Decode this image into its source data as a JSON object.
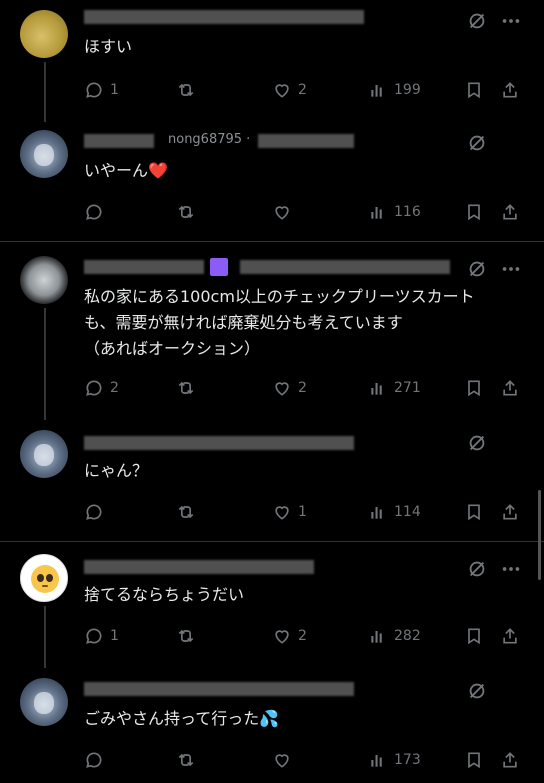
{
  "posts": [
    {
      "text": "ほすい",
      "name_partial": "",
      "handle_partial": "",
      "reply_count": "1",
      "repost_count": "",
      "like_count": "2",
      "view_count": "199"
    },
    {
      "text": "いやーん",
      "emoji": "❤️",
      "name_partial": "",
      "handle_partial": "nong68795 · ",
      "reply_count": "",
      "repost_count": "",
      "like_count": "",
      "view_count": "116"
    },
    {
      "text": "私の家にある100cm以上のチェックプリーツスカート\nも、需要が無ければ廃棄処分も考えています\n（あればオークション）",
      "name_partial": "",
      "handle_partial": "",
      "reply_count": "2",
      "repost_count": "",
      "like_count": "2",
      "view_count": "271"
    },
    {
      "text": "にゃん？",
      "name_partial": "",
      "handle_partial": "",
      "reply_count": "",
      "repost_count": "",
      "like_count": "1",
      "view_count": "114"
    },
    {
      "text": "捨てるならちょうだい",
      "name_partial": "",
      "handle_partial": "",
      "reply_count": "1",
      "repost_count": "",
      "like_count": "2",
      "view_count": "282"
    },
    {
      "text": "ごみやさん持って行った",
      "emoji": "💦",
      "name_partial": "",
      "handle_partial": "",
      "reply_count": "",
      "repost_count": "",
      "like_count": "",
      "view_count": "173"
    }
  ],
  "icons": {
    "reply": "reply-icon",
    "repost": "repost-icon",
    "like": "heart-icon",
    "views": "views-icon",
    "bookmark": "bookmark-icon",
    "share": "share-icon",
    "grok": "grok-icon",
    "more": "more-icon"
  },
  "colors": {
    "background": "#000000",
    "text": "#e7e9ea",
    "muted": "#71767b",
    "heart": "#f91880"
  }
}
